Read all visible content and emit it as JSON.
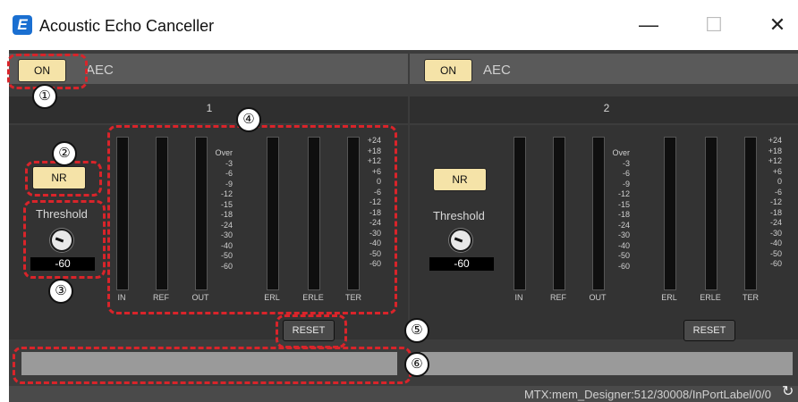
{
  "window": {
    "title": "Acoustic Echo Canceller",
    "app_icon": "E",
    "minimize_glyph": "—",
    "maximize_glyph": "☐",
    "close_glyph": "✕"
  },
  "channels": [
    {
      "number": "1",
      "on_label": "ON",
      "aec_label": "AEC",
      "nr_label": "NR",
      "threshold_label": "Threshold",
      "threshold_value": "-60",
      "reset_label": "RESET",
      "meter_labels": [
        "IN",
        "REF",
        "OUT",
        "ERL",
        "ERLE",
        "TER"
      ]
    },
    {
      "number": "2",
      "on_label": "ON",
      "aec_label": "AEC",
      "nr_label": "NR",
      "threshold_label": "Threshold",
      "threshold_value": "-60",
      "reset_label": "RESET",
      "meter_labels": [
        "IN",
        "REF",
        "OUT",
        "ERL",
        "ERLE",
        "TER"
      ]
    }
  ],
  "scale_left": [
    "Over",
    "-3",
    "-6",
    "-9",
    "-12",
    "-15",
    "-18",
    "-24",
    "-30",
    "-40",
    "-50",
    "-60"
  ],
  "scale_right": [
    "+24",
    "+18",
    "+12",
    "+6",
    "0",
    "-6",
    "-12",
    "-18",
    "-24",
    "-30",
    "-40",
    "-50",
    "-60"
  ],
  "status": {
    "path": "MTX:mem_Designer:512/30008/InPortLabel/0/0",
    "refresh_icon": "refresh-icon"
  },
  "callouts": [
    "①",
    "②",
    "③",
    "④",
    "⑤",
    "⑥"
  ],
  "colors": {
    "button_on": "#f5e3a8",
    "panel_bg": "#3c3c3c",
    "callout": "#d9242a"
  }
}
